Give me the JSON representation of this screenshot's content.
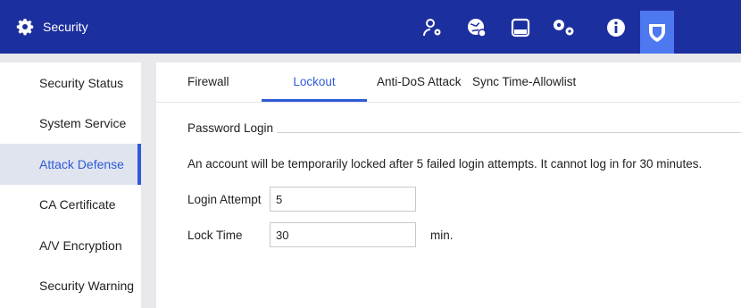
{
  "header": {
    "title": "Security",
    "icons": [
      {
        "name": "user-settings-icon"
      },
      {
        "name": "network-icon"
      },
      {
        "name": "storage-icon"
      },
      {
        "name": "system-settings-icon"
      },
      {
        "name": "info-icon"
      },
      {
        "name": "security-shield-icon",
        "active": true
      }
    ]
  },
  "sidebar": {
    "items": [
      {
        "label": "Security Status"
      },
      {
        "label": "System Service"
      },
      {
        "label": "Attack Defense",
        "active": true
      },
      {
        "label": "CA Certificate"
      },
      {
        "label": "A/V Encryption"
      },
      {
        "label": "Security Warning"
      }
    ]
  },
  "tabs": [
    {
      "label": "Firewall"
    },
    {
      "label": "Lockout",
      "active": true
    },
    {
      "label": "Anti-DoS Attack"
    },
    {
      "label": "Sync Time-Allowlist"
    }
  ],
  "section": {
    "title": "Password Login",
    "notice": "An account will be temporarily locked after 5 failed login attempts. It cannot log in for 30 minutes."
  },
  "form": {
    "login_attempt_label": "Login Attempt",
    "login_attempt_value": "5",
    "lock_time_label": "Lock Time",
    "lock_time_value": "30",
    "lock_time_unit": "min."
  }
}
